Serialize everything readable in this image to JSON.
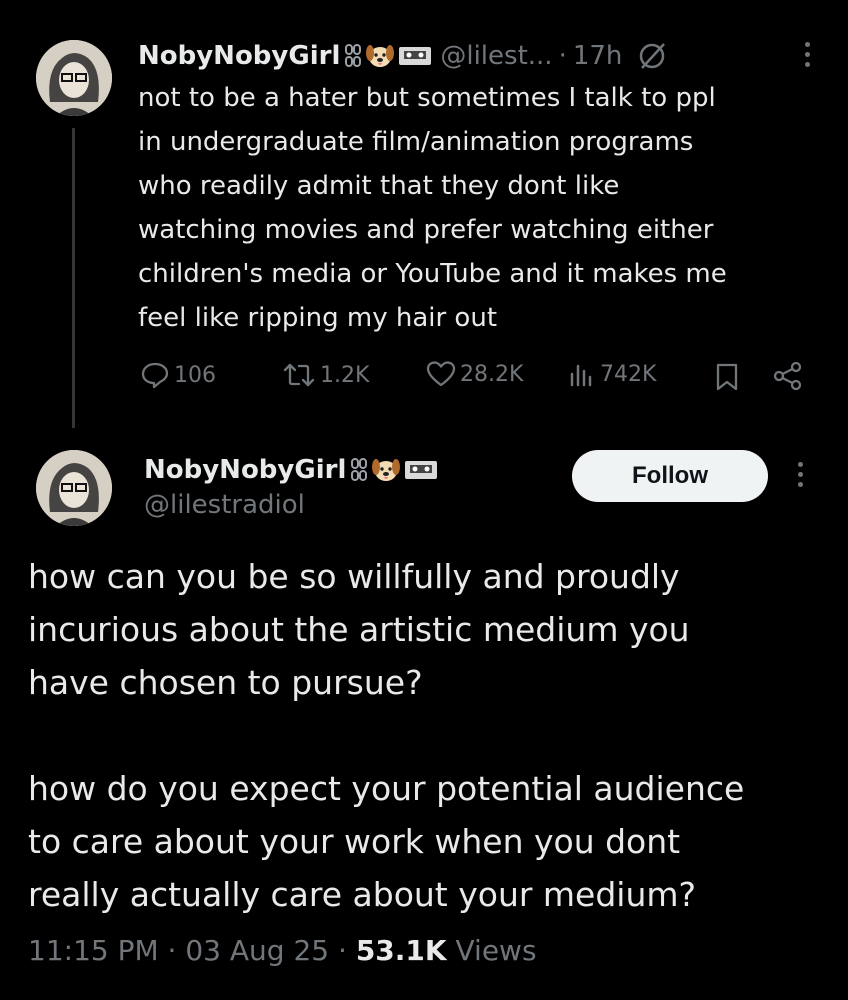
{
  "post1": {
    "display_name": "NobyNobyGirl",
    "handle": "@lilest...",
    "separator": "·",
    "time": "17h",
    "text_lines": [
      "not to be a hater but sometimes I talk to ppl",
      "in undergraduate film/animation programs",
      "who readily admit that they dont like",
      "watching movies and prefer watching either",
      "children's media or YouTube and it makes me",
      "feel like ripping my hair out"
    ],
    "replies": "106",
    "reposts": "1.2K",
    "likes": "28.2K",
    "views": "742K"
  },
  "post2": {
    "display_name": "NobyNobyGirl",
    "handle": "@lilestradiol",
    "follow_label": "Follow",
    "paragraph1": [
      "how can you be so willfully and proudly",
      "incurious about the artistic medium you",
      "have chosen to pursue?"
    ],
    "paragraph2": [
      "how do you expect your potential audience",
      "to care about your work when you dont",
      "really actually care about your medium?"
    ],
    "time": "11:15 PM",
    "date": "03 Aug 25",
    "view_count": "53.1K",
    "views_label": "Views",
    "separator": "·"
  },
  "icons": [
    "chain-icon",
    "dog-face-icon",
    "cassette-icon",
    "circle-slash-icon",
    "more-icon",
    "reply-icon",
    "repost-icon",
    "like-icon",
    "views-icon",
    "bookmark-icon",
    "share-icon"
  ],
  "colors": {
    "background": "#000000",
    "text": "#e7e9ea",
    "secondary": "#71767b",
    "button": "#eff3f4"
  }
}
